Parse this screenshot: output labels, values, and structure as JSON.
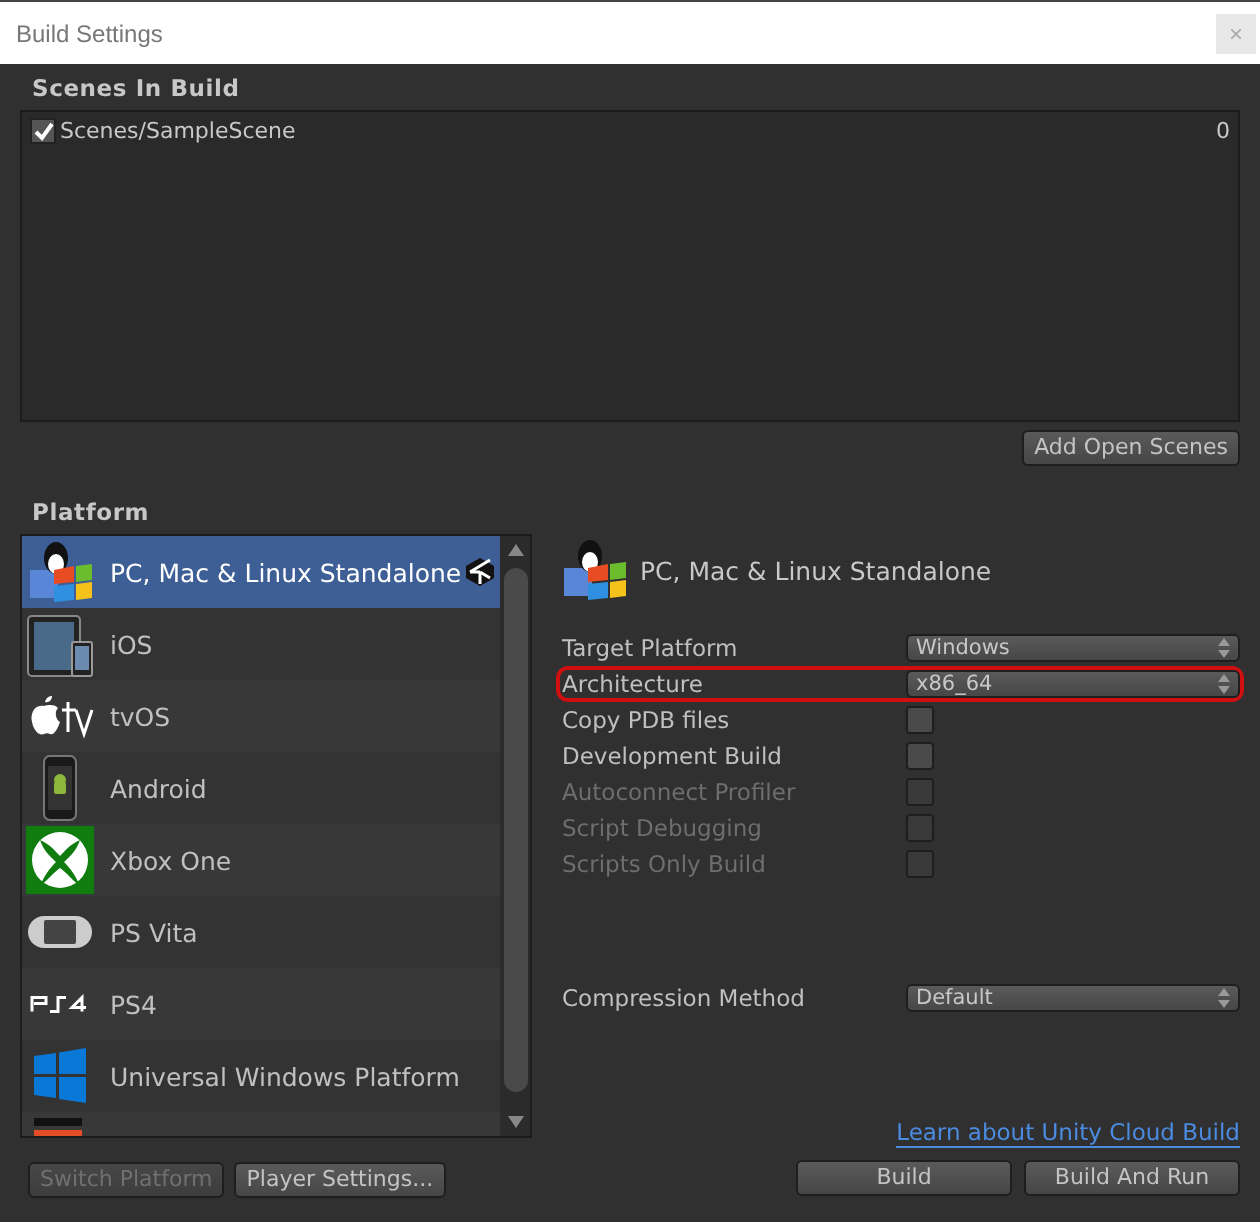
{
  "window": {
    "title": "Build Settings",
    "close": "×"
  },
  "scenes": {
    "heading": "Scenes In Build",
    "items": [
      {
        "name": "Scenes/SampleScene",
        "index": "0",
        "checked": true
      }
    ],
    "add_button": "Add Open Scenes"
  },
  "platform": {
    "heading": "Platform",
    "items": [
      {
        "label": "PC, Mac & Linux Standalone",
        "kind": "standalone",
        "selected": true,
        "active": true
      },
      {
        "label": "iOS",
        "kind": "ios",
        "selected": false,
        "active": false
      },
      {
        "label": "tvOS",
        "kind": "tvos",
        "selected": false,
        "active": false
      },
      {
        "label": "Android",
        "kind": "android",
        "selected": false,
        "active": false
      },
      {
        "label": "Xbox One",
        "kind": "xbox",
        "selected": false,
        "active": false
      },
      {
        "label": "PS Vita",
        "kind": "vita",
        "selected": false,
        "active": false
      },
      {
        "label": "PS4",
        "kind": "ps4",
        "selected": false,
        "active": false
      },
      {
        "label": "Universal Windows Platform",
        "kind": "windows",
        "selected": false,
        "active": false
      },
      {
        "kind": "html5",
        "selected": false,
        "active": false
      }
    ]
  },
  "details": {
    "title": "PC, Mac & Linux Standalone",
    "settings": [
      {
        "kind": "dropdown",
        "label": "Target Platform",
        "value": "Windows",
        "disabled": false,
        "highlighted": false
      },
      {
        "kind": "dropdown",
        "label": "Architecture",
        "value": "x86_64",
        "disabled": false,
        "highlighted": true
      },
      {
        "kind": "checkbox",
        "label": "Copy PDB files",
        "checked": false,
        "disabled": false,
        "highlighted": false
      },
      {
        "kind": "checkbox",
        "label": "Development Build",
        "checked": false,
        "disabled": false,
        "highlighted": false
      },
      {
        "kind": "checkbox",
        "label": "Autoconnect Profiler",
        "checked": false,
        "disabled": true,
        "highlighted": false
      },
      {
        "kind": "checkbox",
        "label": "Script Debugging",
        "checked": false,
        "disabled": true,
        "highlighted": false
      },
      {
        "kind": "checkbox",
        "label": "Scripts Only Build",
        "checked": false,
        "disabled": true,
        "highlighted": false
      }
    ],
    "compression": {
      "label": "Compression Method",
      "value": "Default"
    },
    "cloud_link": "Learn about Unity Cloud Build"
  },
  "buttons": [
    {
      "label": "Switch Platform",
      "disabled": true
    },
    {
      "label": "Player Settings...",
      "disabled": false
    },
    {
      "label": "Build",
      "disabled": false
    },
    {
      "label": "Build And Run",
      "disabled": false
    }
  ]
}
